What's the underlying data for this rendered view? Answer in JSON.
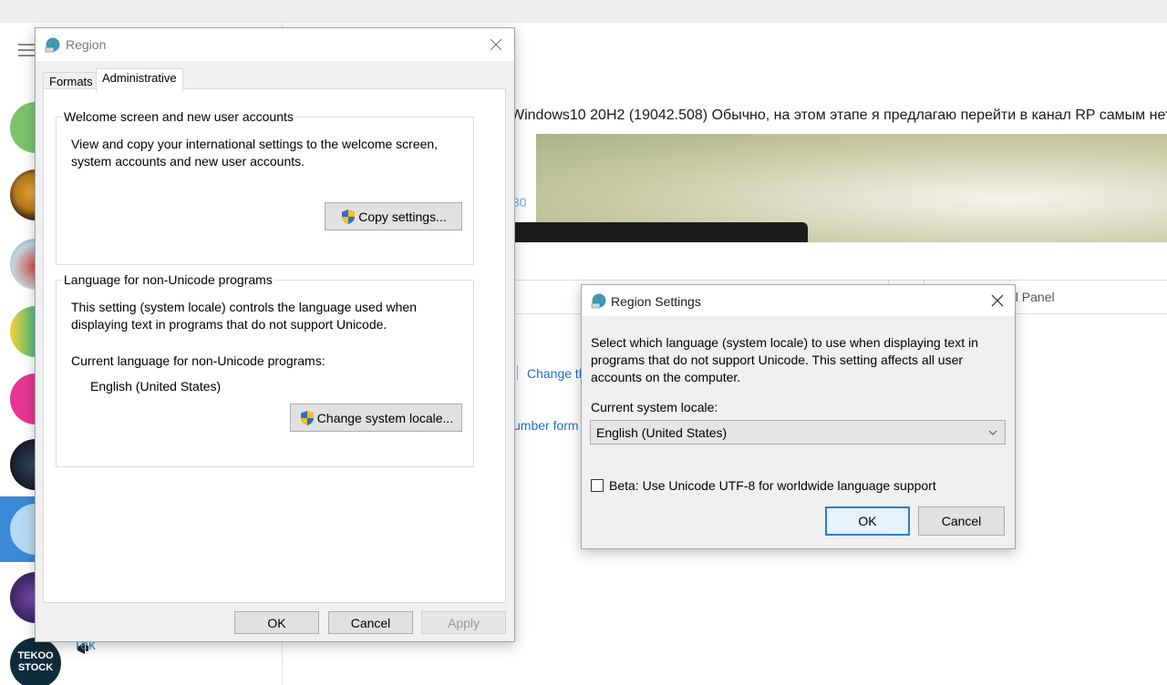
{
  "background": {
    "header_text": "Windows10 20H2 (19042.508)  Обычно, на этом этапе я предлагаю перейти в канал RP самым нетерпеливым",
    "card_number": "30",
    "control_panel_text": "ol Panel",
    "link_change": "Change th",
    "link_number_format": "umber form",
    "chat_preview": "Tek",
    "avatar_tekoo_line1": "TEKOO",
    "avatar_tekoo_line2": "STOCK",
    "colors": {
      "accent": "#3a8ad8",
      "avatar_green": "#7cc36b",
      "avatar_pink": "#e6368f"
    }
  },
  "region_dialog": {
    "title": "Region",
    "tabs": [
      {
        "label": "Formats",
        "active": false
      },
      {
        "label": "Administrative",
        "active": true
      }
    ],
    "welcome_group": {
      "label": "Welcome screen and new user accounts",
      "description_line1": "View and copy your international settings to the welcome screen,",
      "description_line2": "system accounts and new user accounts.",
      "copy_button": "Copy settings..."
    },
    "non_unicode_group": {
      "label": "Language for non-Unicode programs",
      "description_line1": "This setting (system locale) controls the language used when",
      "description_line2": "displaying text in programs that do not support Unicode.",
      "current_label": "Current language for non-Unicode programs:",
      "current_value": "English (United States)",
      "change_button": "Change system locale..."
    },
    "buttons": {
      "ok": "OK",
      "cancel": "Cancel",
      "apply": "Apply"
    }
  },
  "region_settings_dialog": {
    "title": "Region Settings",
    "description_line1": "Select which language (system locale) to use when displaying text in",
    "description_line2": "programs that do not support Unicode. This setting affects all user",
    "description_line3": "accounts on the computer.",
    "locale_label": "Current system locale:",
    "locale_value": "English (United States)",
    "beta_checkbox": {
      "label": "Beta: Use Unicode UTF-8 for worldwide language support",
      "checked": false
    },
    "buttons": {
      "ok": "OK",
      "cancel": "Cancel"
    }
  }
}
